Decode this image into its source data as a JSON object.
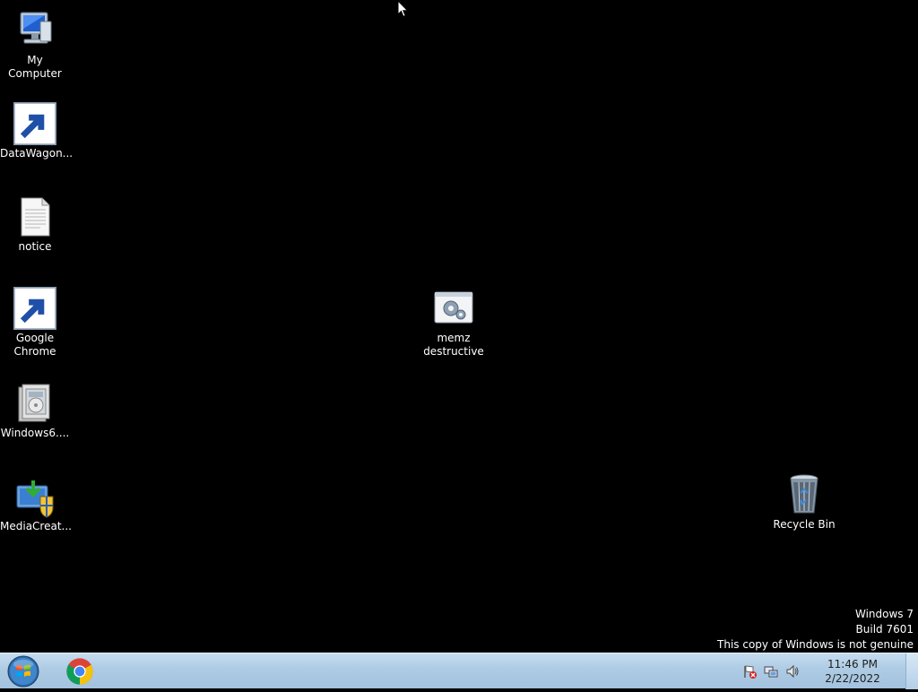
{
  "desktop": {
    "icons": [
      {
        "id": "my-computer",
        "label": "My Computer",
        "icon": "computer-icon"
      },
      {
        "id": "datawagon",
        "label": "DataWagon...",
        "icon": "datawagon-app-icon",
        "shortcut": true
      },
      {
        "id": "notice",
        "label": "notice",
        "icon": "text-document-icon"
      },
      {
        "id": "google-chrome",
        "label": "Google\nChrome",
        "icon": "chrome-icon",
        "shortcut": true
      },
      {
        "id": "windows6",
        "label": "Windows6....",
        "icon": "installer-package-icon"
      },
      {
        "id": "mediacreation",
        "label": "MediaCreat...",
        "icon": "media-creation-tool-icon"
      },
      {
        "id": "memz",
        "label": "memz\ndestructive",
        "icon": "batch-file-gear-icon"
      },
      {
        "id": "recycle-bin",
        "label": "Recycle Bin",
        "icon": "recycle-bin-icon"
      }
    ]
  },
  "watermark": {
    "line1": "Windows 7",
    "line2": "Build 7601",
    "line3": "This copy of Windows is not genuine"
  },
  "taskbar": {
    "start_icon": "windows-orb-icon",
    "pinned": [
      {
        "label": "Google Chrome",
        "icon": "chrome-icon"
      }
    ],
    "tray": {
      "icons": [
        "action-center-flag-icon",
        "network-icon",
        "volume-icon"
      ],
      "time": "11:46 PM",
      "date": "2/22/2022"
    }
  },
  "colors": {
    "desktop_background": "#000000",
    "taskbar": "#aecbe4"
  }
}
